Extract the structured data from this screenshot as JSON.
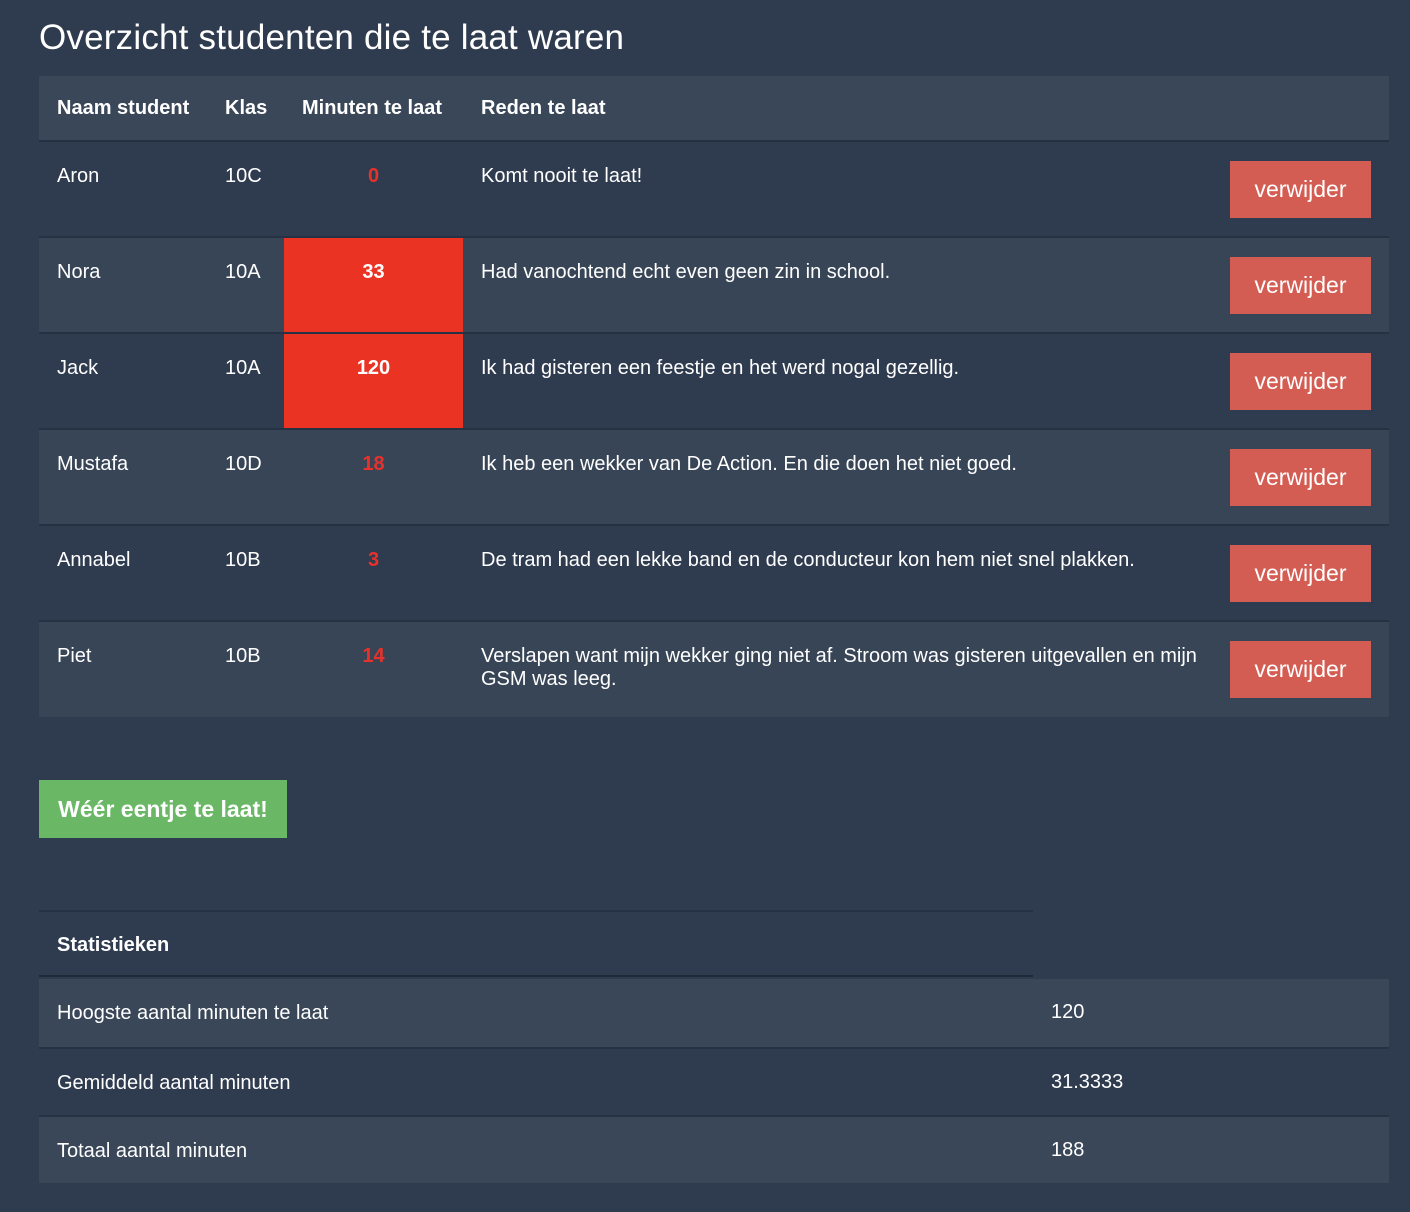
{
  "page_title": "Overzicht studenten die te laat waren",
  "table": {
    "headers": [
      "Naam student",
      "Klas",
      "Minuten te laat",
      "Reden te laat"
    ],
    "rows": [
      {
        "name": "Aron",
        "klas": "10C",
        "minutes": "0",
        "reason": "Komt nooit te laat!",
        "action": "verwijder"
      },
      {
        "name": "Nora",
        "klas": "10A",
        "minutes": "33",
        "reason": "Had vanochtend echt even geen zin in school.",
        "action": "verwijder"
      },
      {
        "name": "Jack",
        "klas": "10A",
        "minutes": "120",
        "reason": "Ik had gisteren een feestje en het werd nogal gezellig.",
        "action": "verwijder"
      },
      {
        "name": "Mustafa",
        "klas": "10D",
        "minutes": "18",
        "reason": "Ik heb een wekker van De Action. En die doen het niet goed.",
        "action": "verwijder"
      },
      {
        "name": "Annabel",
        "klas": "10B",
        "minutes": "3",
        "reason": "De tram had een lekke band en de conducteur kon hem niet snel plakken.",
        "action": "verwijder"
      },
      {
        "name": "Piet",
        "klas": "10B",
        "minutes": "14",
        "reason": "Verslapen want mijn wekker ging niet af. Stroom was gisteren uitgevallen en mijn GSM was leeg.",
        "action": "verwijder"
      }
    ]
  },
  "add_button_label": "Wéér eentje te laat!",
  "stats": {
    "heading": "Statistieken",
    "rows": [
      {
        "label": "Hoogste aantal minuten te laat",
        "value": "120"
      },
      {
        "label": "Gemiddeld aantal minuten",
        "value": "31.3333"
      },
      {
        "label": "Totaal aantal minuten",
        "value": "188"
      }
    ]
  },
  "colors": {
    "background": "#2f3b4e",
    "row_alt": "#384556",
    "late_highlight": "#ea3323",
    "delete_button": "#d35d53",
    "add_button": "#6ab866"
  }
}
